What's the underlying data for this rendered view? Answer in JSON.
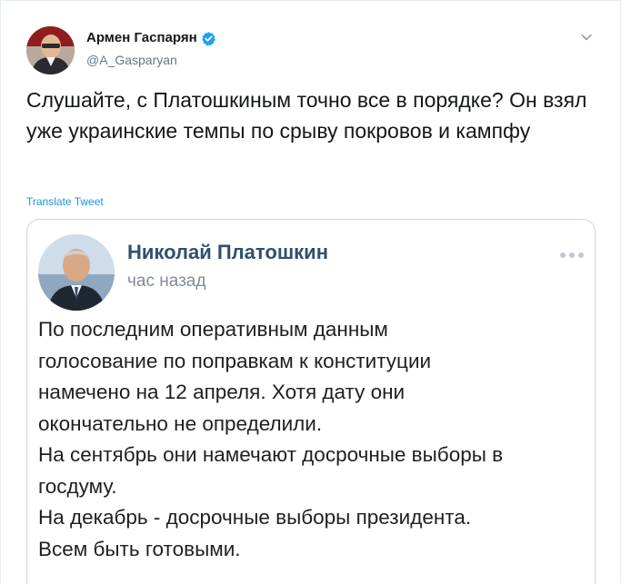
{
  "author": {
    "name": "Армен Гаспарян",
    "handle": "@A_Gasparyan",
    "verified": true,
    "avatar_icon": "author-avatar"
  },
  "tweet": {
    "text": "Слушайте, с Платошкиным точно все в порядке? Он взял уже украинские темпы по срыву покровов и кампфу",
    "translate_label": "Translate Tweet"
  },
  "embedded_post": {
    "author_name": "Николай Платошкин",
    "time": "час назад",
    "lines": [
      "По последним оперативным данным",
      "голосование по поправкам к конституции",
      "намечено на 12 апреля. Хотя дату они",
      "окончательно не определили.",
      "На сентябрь они намечают досрочные выборы в",
      "госдуму.",
      "На декабрь - досрочные выборы президента.",
      "Всем быть готовыми."
    ]
  },
  "colors": {
    "link": "#1b95e0",
    "verified": "#1da1f2",
    "embed_name": "#2f4f70",
    "muted": "#657786"
  }
}
